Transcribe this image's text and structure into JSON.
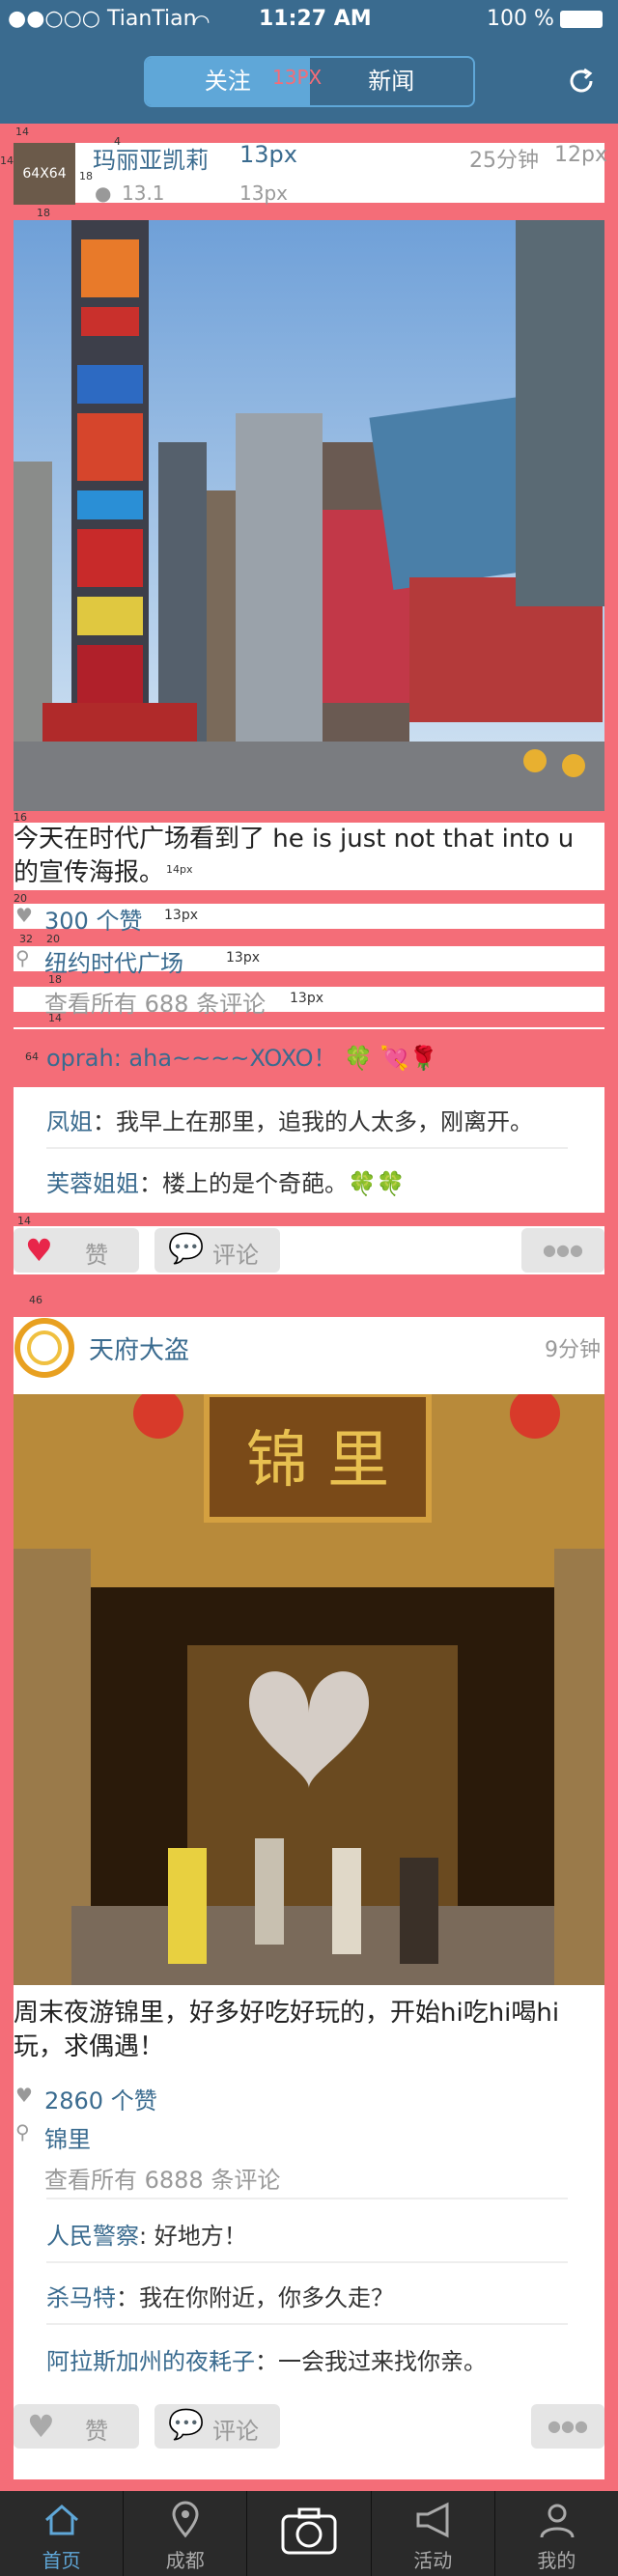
{
  "status_bar": {
    "carrier": "●●○○○ TianTian",
    "time": "11:27 AM",
    "battery": "100 %"
  },
  "header": {
    "tab_follow": "关注",
    "tab_news": "新闻",
    "tab_note": "13PX"
  },
  "post1": {
    "avatar_label": "64X64",
    "author": "玛丽亚凯莉",
    "name_note": "13px",
    "time": "25分钟",
    "time_note": "12px",
    "sub_value": "13.1",
    "sub_note": "13px",
    "text": "今天在时代广场看到了 he is just not that into u 的宣传海报。",
    "text_note": "14px",
    "likes": "300 个赞",
    "likes_note": "13px",
    "location": "纽约时代广场",
    "location_note": "13px",
    "view_comments": "查看所有 688 条评论",
    "view_note": "13px",
    "comments": [
      {
        "name": "oprah",
        "text": "aha~~~~XOXO！ 🍀 💘🌹"
      },
      {
        "name": "凤姐",
        "text": "我早上在那里，追我的人太多，刚离开。"
      },
      {
        "name": "芙蓉姐姐",
        "text": "楼上的是个奇葩。🍀🍀"
      }
    ],
    "like_btn": "赞",
    "comment_btn": "评论",
    "more_btn": "●●●"
  },
  "post2": {
    "author": "天府大盗",
    "time": "9分钟",
    "text": "周末夜游锦里，好多好吃好玩的，开始hi吃hi喝hi玩，求偶遇！",
    "likes": "2860 个赞",
    "location": "锦里",
    "view_comments": "查看所有 6888 条评论",
    "comments": [
      {
        "name": "人民警察",
        "text": "好地方！"
      },
      {
        "name": "杀马特",
        "text": "我在你附近，你多久走？"
      },
      {
        "name": "阿拉斯加州的夜耗子",
        "text": "一会我过来找你亲。"
      }
    ],
    "sign_text": "锦 里",
    "like_btn": "赞",
    "comment_btn": "评论",
    "more_btn": "●●●"
  },
  "annotations": [
    "14",
    "4",
    "18",
    "18",
    "14",
    "16",
    "20",
    "32",
    "20",
    "18",
    "14",
    "64",
    "14",
    "46"
  ],
  "tabbar": [
    "首页",
    "成都",
    "",
    "活动",
    "我的"
  ],
  "colors": {
    "primary": "#3a6b8f",
    "accent": "#5fa7d8",
    "guide": "#f46d78",
    "like": "#e8264a"
  }
}
